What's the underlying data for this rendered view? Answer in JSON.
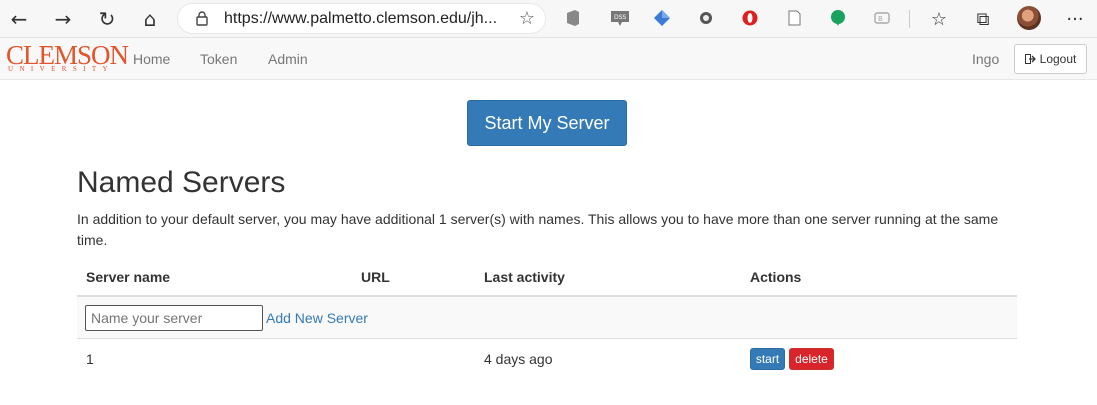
{
  "browser": {
    "url": "https://www.palmetto.clemson.edu/jh...",
    "back_icon": "←",
    "forward_icon": "→",
    "reload_icon": "↻",
    "home_icon": "⌂",
    "star_icon": "☆",
    "favorites_icon": "☆",
    "collections_icon": "⧉",
    "menu_icon": "···"
  },
  "header": {
    "logo_main": "CLEMSON",
    "logo_sub": "UNIVERSITY",
    "nav": {
      "home": "Home",
      "token": "Token",
      "admin": "Admin"
    },
    "user": "Ingo",
    "logout_label": "Logout"
  },
  "main": {
    "start_button": "Start My Server",
    "title": "Named Servers",
    "description": "In addition to your default server, you may have additional 1 server(s) with names. This allows you to have more than one server running at the same time.",
    "table": {
      "headers": {
        "name": "Server name",
        "url": "URL",
        "activity": "Last activity",
        "actions": "Actions"
      },
      "new_server_placeholder": "Name your server",
      "add_label": "Add New Server",
      "rows": [
        {
          "name": "1",
          "url": "",
          "last_activity": "4 days ago",
          "start": "start",
          "delete": "delete"
        }
      ]
    }
  },
  "colors": {
    "primary": "#337ab7",
    "danger": "#d9242b",
    "brand": "#e2542a"
  }
}
